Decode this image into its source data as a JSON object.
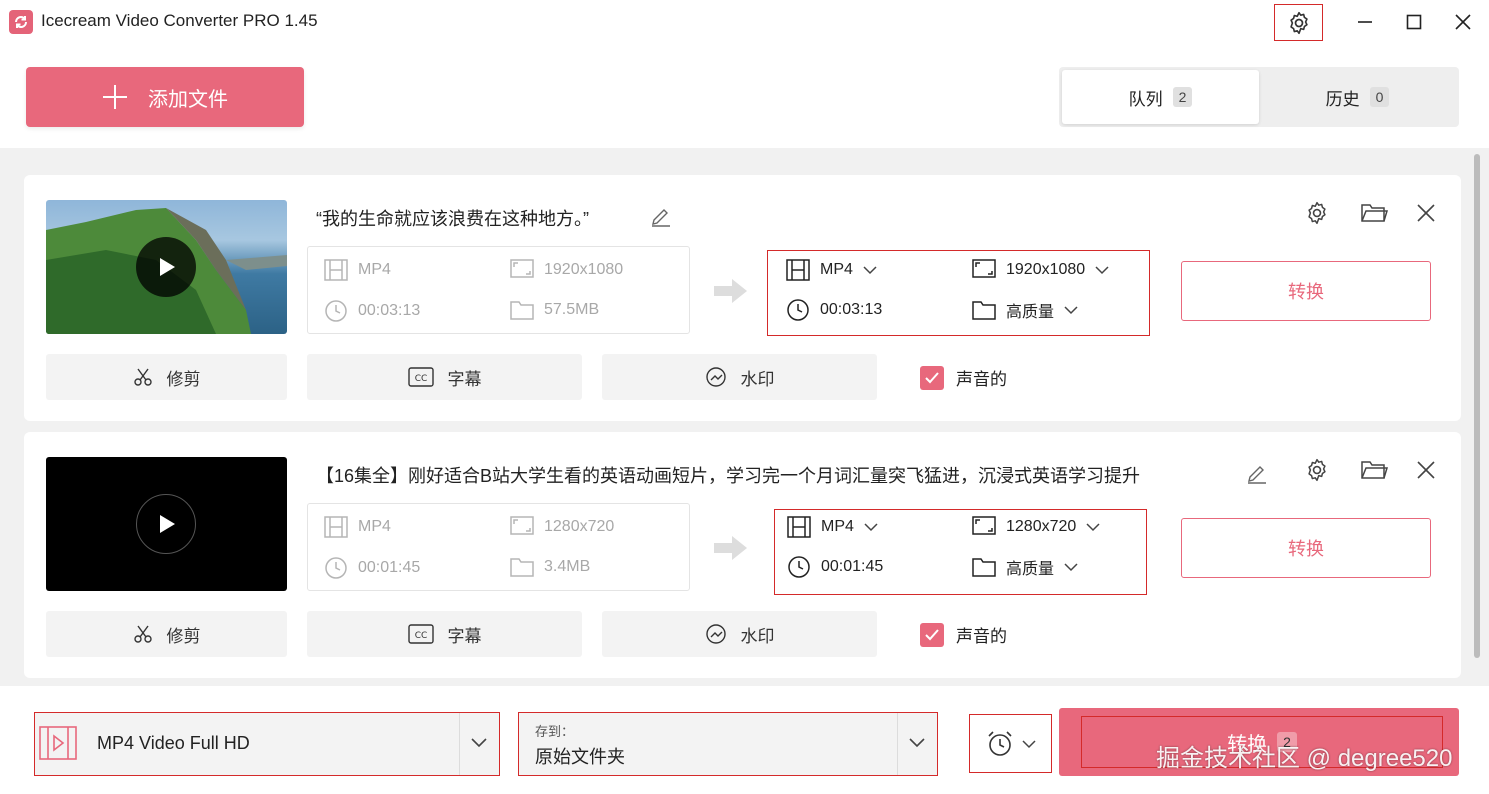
{
  "app": {
    "title": "Icecream Video Converter PRO 1.45"
  },
  "toolbar": {
    "add_label": "添加文件"
  },
  "tabs": [
    {
      "label": "队列",
      "count": "2"
    },
    {
      "label": "历史",
      "count": "0"
    }
  ],
  "items": [
    {
      "title": "“我的生命就应该浪费在这种地方。”",
      "source": {
        "format": "MP4",
        "resolution": "1920x1080",
        "duration": "00:03:13",
        "size": "57.5MB"
      },
      "output": {
        "format": "MP4",
        "resolution": "1920x1080",
        "duration": "00:03:13",
        "quality": "高质量"
      },
      "convert_label": "转换",
      "tools": {
        "trim": "修剪",
        "subtitle": "字幕",
        "watermark": "水印"
      },
      "audio_label": "声音的",
      "audio_checked": true
    },
    {
      "title": "【16集全】刚好适合B站大学生看的英语动画短片，学习完一个月词汇量突飞猛进，沉浸式英语学习提升",
      "source": {
        "format": "MP4",
        "resolution": "1280x720",
        "duration": "00:01:45",
        "size": "3.4MB"
      },
      "output": {
        "format": "MP4",
        "resolution": "1280x720",
        "duration": "00:01:45",
        "quality": "高质量"
      },
      "convert_label": "转换",
      "tools": {
        "trim": "修剪",
        "subtitle": "字幕",
        "watermark": "水印"
      },
      "audio_label": "声音的",
      "audio_checked": true
    }
  ],
  "bottom": {
    "preset": "MP4 Video Full HD",
    "save_to_label": "存到：",
    "save_to_value": "原始文件夹",
    "convert_label": "转换",
    "convert_count": "2"
  },
  "watermark_text": "掘金技术社区 @ degree520",
  "colors": {
    "accent": "#e8687c",
    "highlight_border": "#d42a2a"
  }
}
